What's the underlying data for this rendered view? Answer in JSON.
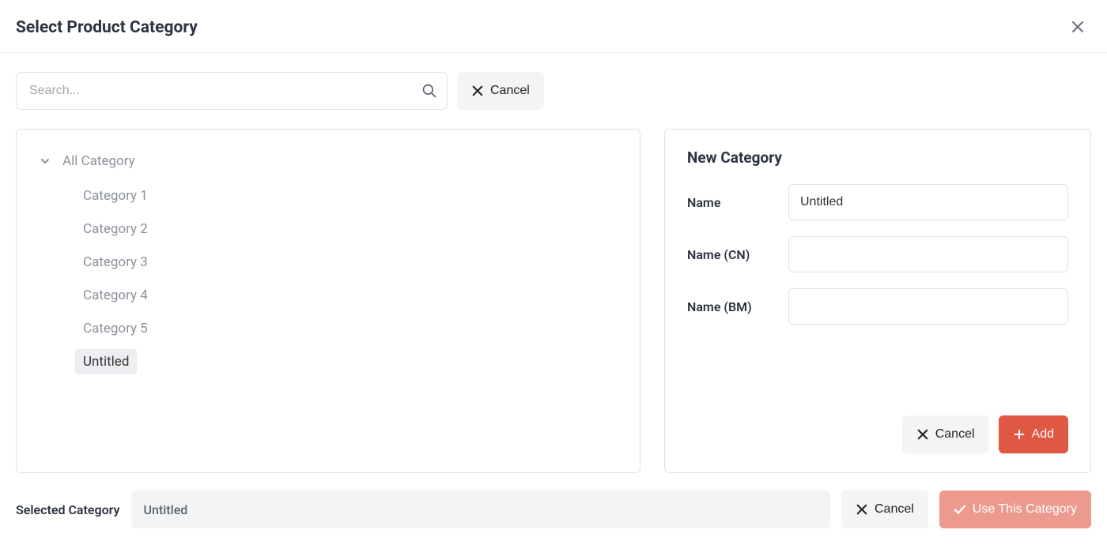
{
  "header": {
    "title": "Select Product Category"
  },
  "toolbar": {
    "search_placeholder": "Search...",
    "cancel_label": "Cancel"
  },
  "tree": {
    "root_label": "All Category",
    "items": [
      {
        "label": "Category 1",
        "selected": false
      },
      {
        "label": "Category 2",
        "selected": false
      },
      {
        "label": "Category 3",
        "selected": false
      },
      {
        "label": "Category 4",
        "selected": false
      },
      {
        "label": "Category 5",
        "selected": false
      },
      {
        "label": "Untitled",
        "selected": true
      }
    ]
  },
  "form": {
    "title": "New Category",
    "fields": {
      "name": {
        "label": "Name",
        "value": "Untitled"
      },
      "name_cn": {
        "label": "Name (CN)",
        "value": ""
      },
      "name_bm": {
        "label": "Name (BM)",
        "value": ""
      }
    },
    "cancel_label": "Cancel",
    "add_label": "Add"
  },
  "footer": {
    "selected_label": "Selected Category",
    "selected_value": "Untitled",
    "cancel_label": "Cancel",
    "use_label": "Use This Category"
  }
}
